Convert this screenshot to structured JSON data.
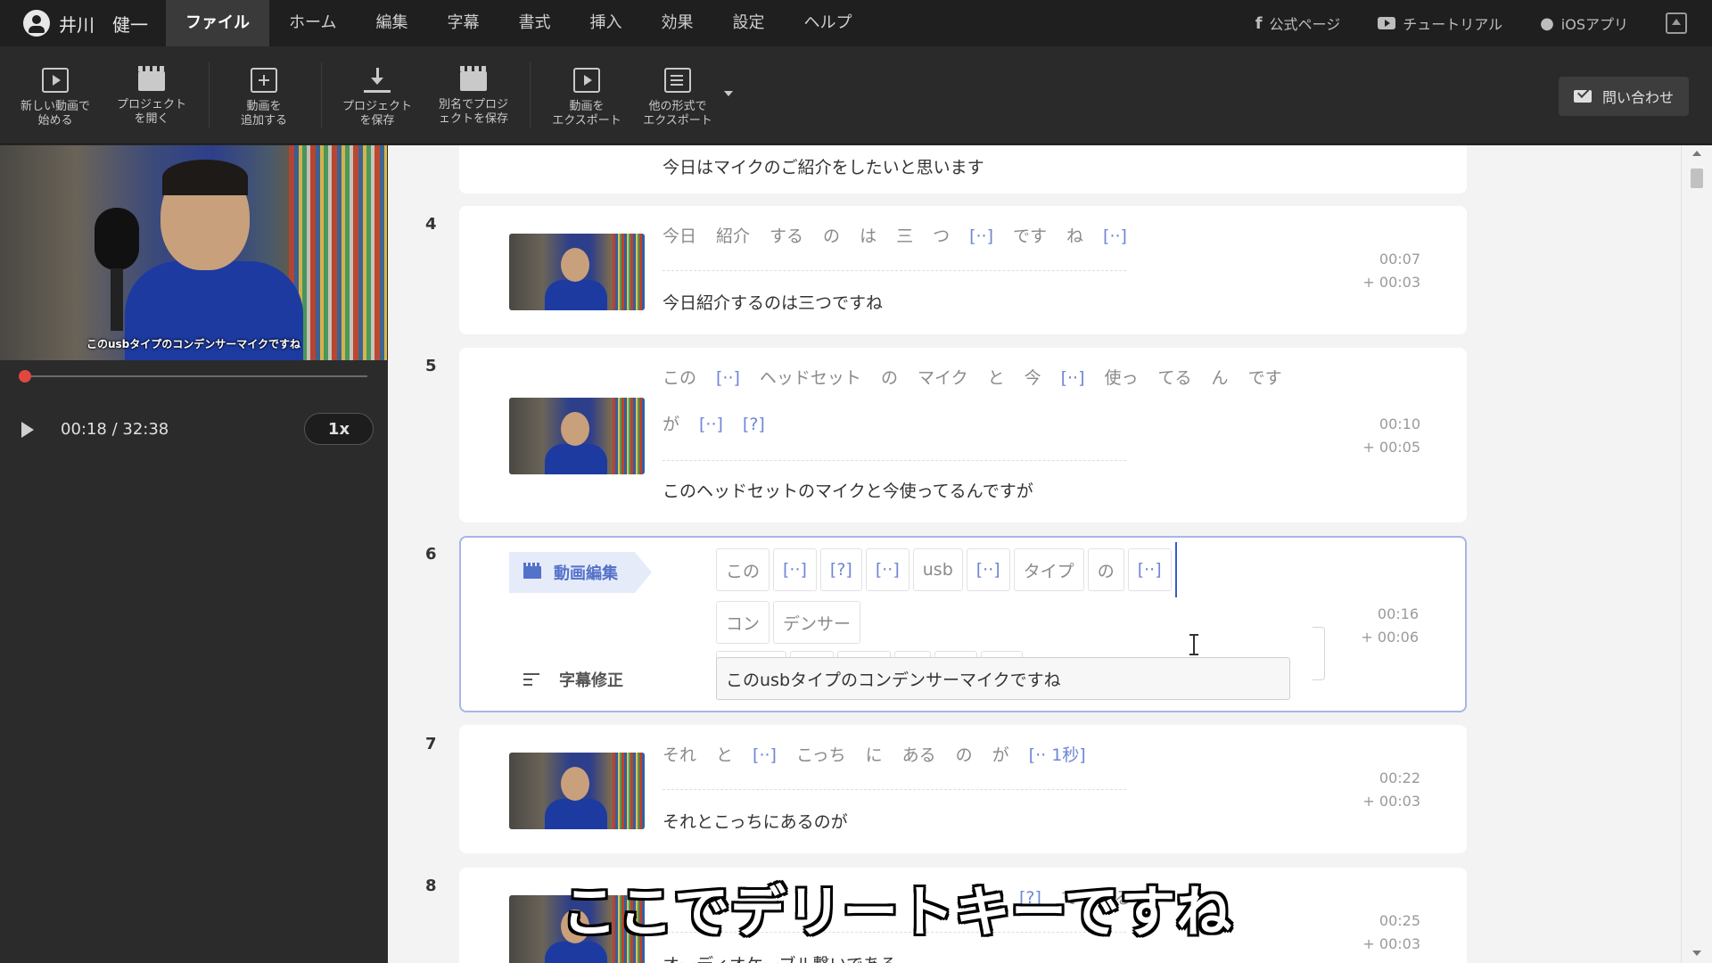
{
  "user": {
    "name": "井川　健一"
  },
  "menu": [
    {
      "label": "ファイル",
      "active": true
    },
    {
      "label": "ホーム"
    },
    {
      "label": "編集"
    },
    {
      "label": "字幕"
    },
    {
      "label": "書式"
    },
    {
      "label": "挿入"
    },
    {
      "label": "効果"
    },
    {
      "label": "設定"
    },
    {
      "label": "ヘルプ"
    }
  ],
  "links": {
    "official": "公式ページ",
    "tutorial": "チュートリアル",
    "ios": "iOSアプリ"
  },
  "toolbar": {
    "new_video": [
      "新しい動画で",
      "始める"
    ],
    "open_project": [
      "プロジェクト",
      "を開く"
    ],
    "add_video": [
      "動画を",
      "追加する"
    ],
    "save_project": [
      "プロジェクト",
      "を保存"
    ],
    "save_as": [
      "別名でプロジ",
      "ェクトを保存"
    ],
    "export_video": [
      "動画を",
      "エクスポート"
    ],
    "export_other": [
      "他の形式で",
      "エクスポート"
    ],
    "contact": "問い合わせ"
  },
  "player": {
    "video_caption": "このusbタイプのコンデンサーマイクですね",
    "time": "00:18 / 32:38",
    "speed": "1x",
    "progress": 0.01
  },
  "rows": {
    "r3": {
      "subtitle": "今日はマイクのご紹介をしたいと思います"
    },
    "r4": {
      "num": "4",
      "tokens": [
        "今日",
        "紹介",
        "する",
        "の",
        "は",
        "三",
        "つ",
        "[··]",
        "です",
        "ね",
        "[··]"
      ],
      "subtitle": "今日紹介するのは三つですね",
      "start": "00:07",
      "dur": "+ 00:03"
    },
    "r5": {
      "num": "5",
      "tokens": [
        "この",
        "[··]",
        "ヘッドセット",
        "の",
        "マイク",
        "と",
        "今",
        "[··]",
        "使っ",
        "てる",
        "ん",
        "です",
        "が",
        "[··]",
        "[?]"
      ],
      "subtitle": "このヘッドセットのマイクと今使ってるんですが",
      "start": "00:10",
      "dur": "+ 00:05"
    },
    "r6": {
      "num": "6",
      "edit_tag": "動画編集",
      "sub_fix": "字幕修正",
      "chips1": [
        "この",
        "[··]",
        "[?]",
        "[··]",
        "usb",
        "[··]",
        "タイプ",
        "の",
        "[··]"
      ],
      "chips2": [
        "コン",
        "デンサー"
      ],
      "chips3": [
        "マイク",
        "[··]",
        "です",
        "ね",
        "[··]",
        "[?]"
      ],
      "subtitle": "このusbタイプのコンデンサーマイクですね",
      "start": "00:16",
      "dur": "+ 00:06"
    },
    "r7": {
      "num": "7",
      "tokens": [
        "それ",
        "と",
        "[··]",
        "こっち",
        "に",
        "ある",
        "の",
        "が",
        "[·· 1秒]"
      ],
      "subtitle": "それとこっちにあるのが",
      "start": "00:22",
      "dur": "+ 00:03"
    },
    "r8": {
      "num": "8",
      "tokens_visible": [
        "[?]",
        "で",
        "ある"
      ],
      "subtitle": "オーディオケーブル繋いである",
      "start": "00:25",
      "dur": "+ 00:03"
    }
  },
  "overlay_caption": "ここでデリートキーですね",
  "colors": {
    "accent": "#5472c8",
    "filler": "#6e86d6",
    "seek": "#e2473f"
  }
}
